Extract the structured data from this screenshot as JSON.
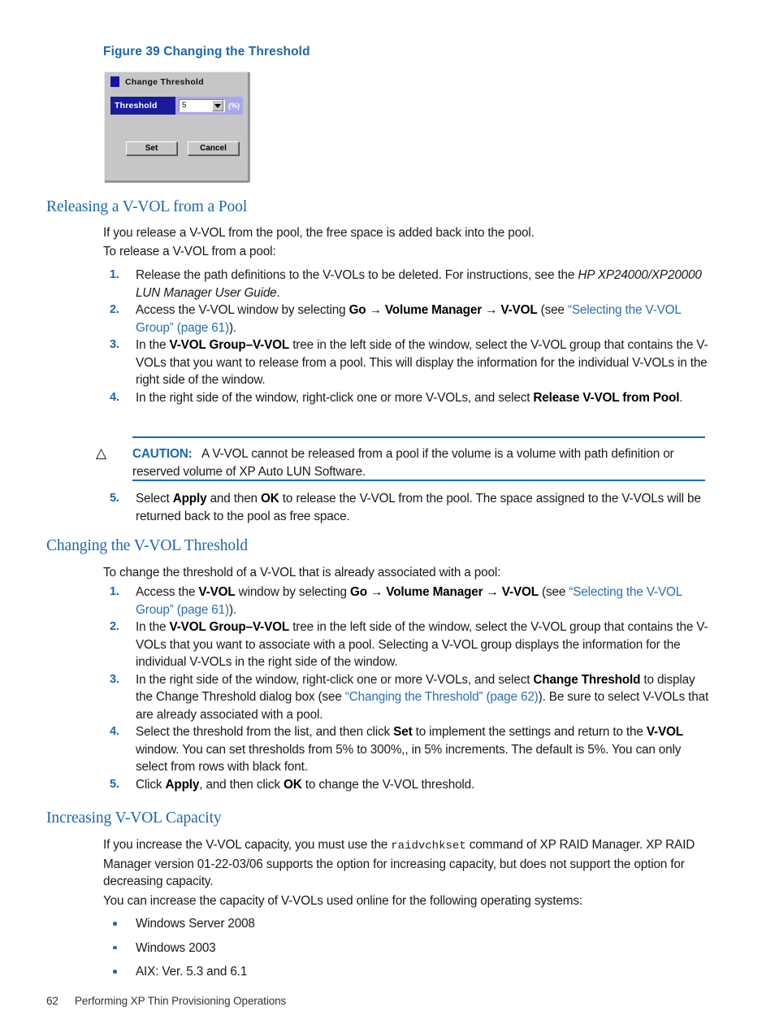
{
  "figure": {
    "caption": "Figure 39 Changing the Threshold",
    "dialog": {
      "title": "Change Threshold",
      "title_icon": "window-icon",
      "threshold_label": "Threshold",
      "threshold_value": "5",
      "threshold_unit": "(%)",
      "dropdown_icon": "chevron-down-icon",
      "set_button": "Set",
      "cancel_button": "Cancel"
    }
  },
  "sections": [
    {
      "heading": "Releasing a V-VOL from a Pool",
      "intro1": "If you release a V-VOL from the pool, the free space is added back into the pool.",
      "intro2": "To release a V-VOL from a pool:",
      "steps": [
        {
          "num": "1.",
          "html": "Release the path definitions to the V-VOLs to be deleted. For instructions, see the <i>HP XP24000/XP20000 LUN Manager User Guide</i>."
        },
        {
          "num": "2.",
          "html": "Access the V-VOL window by selecting <b>Go → Volume Manager → V-VOL</b> (see <span class=\"lnk\">“Selecting the V-VOL Group” (page 61)</span>)."
        },
        {
          "num": "3.",
          "html": "In the <b>V-VOL Group–V-VOL</b> tree in the left side of the window, select the V-VOL group that contains the V-VOLs that you want to release from a pool. This will display the information for the individual V-VOLs in the right side of the window."
        },
        {
          "num": "4.",
          "html": "In the right side of the window, right-click one or more V-VOLs, and select <b>Release V-VOL from Pool</b>."
        }
      ],
      "caution": {
        "icon": "caution-triangle-icon",
        "label": "CAUTION:",
        "text": "A V-VOL cannot be released from a pool if the volume is a volume with path definition or reserved volume of XP Auto LUN Software."
      },
      "steps_after": [
        {
          "num": "5.",
          "html": "Select <b>Apply</b> and then <b>OK</b> to release the V-VOL from the pool. The space assigned to the V-VOLs will be returned back to the pool as free space."
        }
      ]
    },
    {
      "heading": "Changing the V-VOL Threshold",
      "intro1": "To change the threshold of a V-VOL that is already associated with a pool:",
      "steps": [
        {
          "num": "1.",
          "html": "Access the <b>V-VOL</b> window by selecting <b>Go → Volume Manager → V-VOL</b> (see <span class=\"lnk\">“Selecting the V-VOL Group” (page 61)</span>)."
        },
        {
          "num": "2.",
          "html": "In the <b>V-VOL Group–V-VOL</b> tree in the left side of the window, select the V-VOL group that contains the V-VOLs that you want to associate with a pool. Selecting a V-VOL group displays the information for the individual V-VOLs in the right side of the window."
        },
        {
          "num": "3.",
          "html": "In the right side of the window, right-click one or more V-VOLs, and select <b>Change Threshold</b> to display the Change Threshold dialog box (see <span class=\"lnk\">“Changing the Threshold” (page 62)</span>). Be sure to select V-VOLs that are already associated with a pool."
        },
        {
          "num": "4.",
          "html": "Select the threshold from the list, and then click <b>Set</b> to implement the settings and return to the <b>V-VOL</b> window. You can set thresholds from 5% to 300%,, in 5% increments. The default is 5%. You can only select from rows with black font."
        },
        {
          "num": "5.",
          "html": "Click <b>Apply</b>, and then click <b>OK</b> to change the V-VOL threshold."
        }
      ]
    },
    {
      "heading": "Increasing V-VOL Capacity",
      "intro1": "If you increase the V-VOL capacity, you must use the <span class=\"mono\">raidvchkset</span> command of XP RAID Manager. XP RAID Manager version 01-22-03/06 supports the option for increasing capacity, but does not support the option for decreasing capacity.",
      "intro2": "You can increase the capacity of V-VOLs used online for the following operating systems:",
      "bullets": [
        "Windows Server 2008",
        "Windows 2003",
        "AIX: Ver. 5.3 and 6.1"
      ]
    }
  ],
  "footer": {
    "page_number": "62",
    "chapter_title": "Performing XP Thin Provisioning Operations"
  },
  "colors": {
    "heading_blue": "#1b68b0",
    "link_blue": "#2a6fb0",
    "dialog_title_blue": "#1a1a9c",
    "dialog_face": "#c6c6c6"
  }
}
